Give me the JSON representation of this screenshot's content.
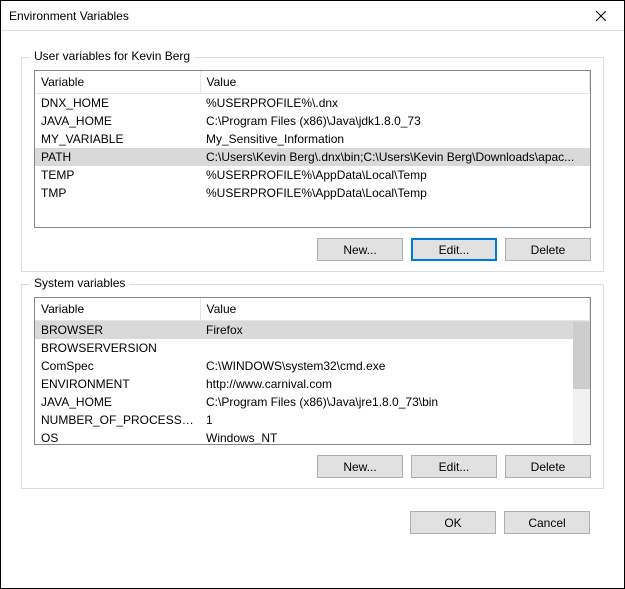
{
  "window": {
    "title": "Environment Variables"
  },
  "user_section": {
    "title": "User variables for Kevin Berg",
    "headers": {
      "variable": "Variable",
      "value": "Value"
    },
    "rows": [
      {
        "name": "DNX_HOME",
        "value": "%USERPROFILE%\\.dnx",
        "selected": false
      },
      {
        "name": "JAVA_HOME",
        "value": "C:\\Program Files (x86)\\Java\\jdk1.8.0_73",
        "selected": false
      },
      {
        "name": "MY_VARIABLE",
        "value": "My_Sensitive_Information",
        "selected": false
      },
      {
        "name": "PATH",
        "value": "C:\\Users\\Kevin Berg\\.dnx\\bin;C:\\Users\\Kevin Berg\\Downloads\\apac...",
        "selected": true
      },
      {
        "name": "TEMP",
        "value": "%USERPROFILE%\\AppData\\Local\\Temp",
        "selected": false
      },
      {
        "name": "TMP",
        "value": "%USERPROFILE%\\AppData\\Local\\Temp",
        "selected": false
      }
    ],
    "buttons": {
      "new": "New...",
      "edit": "Edit...",
      "delete": "Delete"
    }
  },
  "system_section": {
    "title": "System variables",
    "headers": {
      "variable": "Variable",
      "value": "Value"
    },
    "rows": [
      {
        "name": "BROWSER",
        "value": "Firefox",
        "selected": true
      },
      {
        "name": "BROWSERVERSION",
        "value": "",
        "selected": false
      },
      {
        "name": "ComSpec",
        "value": "C:\\WINDOWS\\system32\\cmd.exe",
        "selected": false
      },
      {
        "name": "ENVIRONMENT",
        "value": "http://www.carnival.com",
        "selected": false
      },
      {
        "name": "JAVA_HOME",
        "value": "C:\\Program Files (x86)\\Java\\jre1.8.0_73\\bin",
        "selected": false
      },
      {
        "name": "NUMBER_OF_PROCESSORS",
        "value": "1",
        "selected": false
      },
      {
        "name": "OS",
        "value": "Windows_NT",
        "selected": false
      }
    ],
    "buttons": {
      "new": "New...",
      "edit": "Edit...",
      "delete": "Delete"
    }
  },
  "footer": {
    "ok": "OK",
    "cancel": "Cancel"
  }
}
